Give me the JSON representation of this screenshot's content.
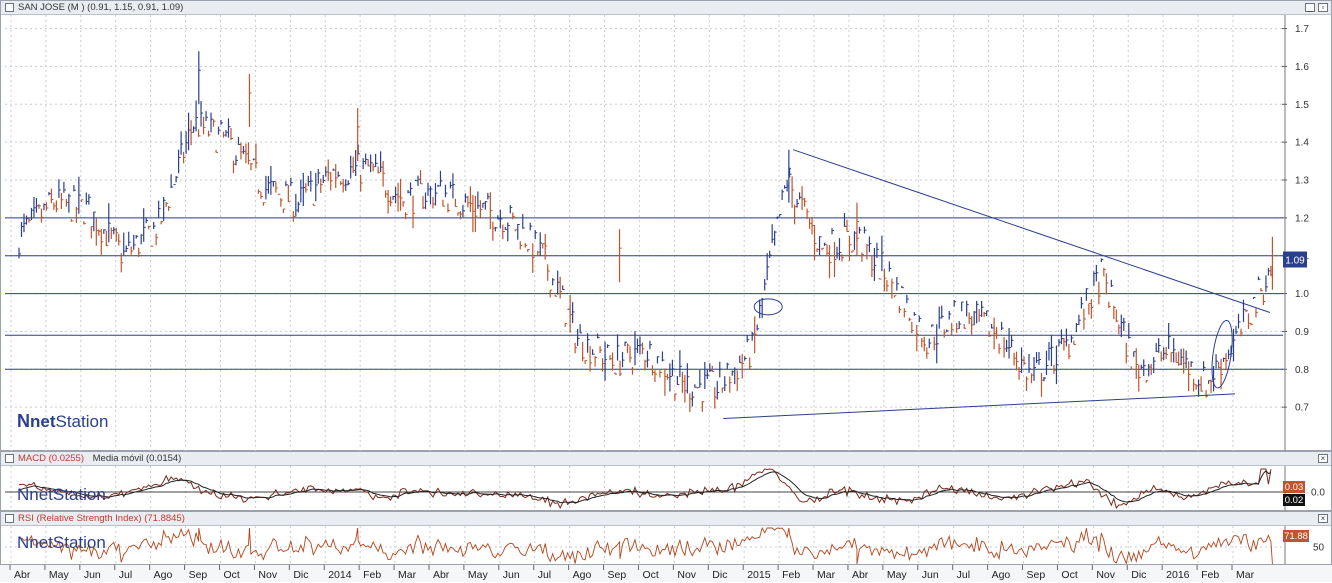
{
  "main_panel": {
    "title": "SAN JOSE (M )",
    "ohlc": "(0.91, 1.15, 0.91, 1.09)",
    "last_price_badge": "1.09",
    "logo_text_net": "net",
    "logo_text_station": "Station"
  },
  "macd_panel": {
    "title": "MACD (0.0255)",
    "subtitle": "Media móvil (0.0154)",
    "badge_macd": "0.03",
    "badge_signal": "0.02"
  },
  "rsi_panel": {
    "title": "RSI (Relative Strength Index) (71.8845)",
    "badge_value": "71.88"
  },
  "colors": {
    "bars_up": "#2b3f8f",
    "bars_down": "#c0542a",
    "hline": "#2b3f8f",
    "grid": "#c8ccd2",
    "rsi_line": "#b5451b",
    "macd_line": "#7a2a1a",
    "signal_line": "#222222",
    "badge_main": "#2b3f8f",
    "badge_rsi": "#c0542a"
  },
  "chart_data": [
    {
      "type": "ohlc",
      "series_name": "SAN JOSE",
      "y_ticks": [
        "0.7",
        "0.8",
        "0.9",
        "1.0",
        "1.1",
        "1.2",
        "1.3",
        "1.4",
        "1.5",
        "1.6",
        "1.7"
      ],
      "ylim": [
        0.6,
        1.72
      ],
      "horizontal_lines": [
        1.2,
        1.1,
        1.0,
        0.89,
        0.8
      ],
      "x_labels": [
        "Abr",
        "May",
        "Jun",
        "Jul",
        "Ago",
        "Sep",
        "Oct",
        "Nov",
        "Dic",
        "2014",
        "Feb",
        "Mar",
        "Abr",
        "May",
        "Jun",
        "Jul",
        "Ago",
        "Sep",
        "Oct",
        "Nov",
        "Dic",
        "2015",
        "Feb",
        "Mar",
        "Abr",
        "May",
        "Jun",
        "Jul",
        "Ago",
        "Sep",
        "Oct",
        "Nov",
        "Dic",
        "2016",
        "Feb",
        "Mar"
      ],
      "key_points": [
        {
          "date": "2013-04",
          "close": 1.15
        },
        {
          "date": "2013-05",
          "close": 1.24
        },
        {
          "date": "2013-06",
          "close": 1.22
        },
        {
          "date": "2013-07",
          "close": 1.1
        },
        {
          "date": "2013-08",
          "close": 1.18
        },
        {
          "date": "2013-09",
          "close": 1.45
        },
        {
          "date": "2013-10",
          "close": 1.4
        },
        {
          "date": "2013-11",
          "close": 1.28
        },
        {
          "date": "2013-12",
          "close": 1.24
        },
        {
          "date": "2014-01",
          "close": 1.32
        },
        {
          "date": "2014-02",
          "close": 1.33
        },
        {
          "date": "2014-03",
          "close": 1.25
        },
        {
          "date": "2014-04",
          "close": 1.27
        },
        {
          "date": "2014-05",
          "close": 1.23
        },
        {
          "date": "2014-06",
          "close": 1.2
        },
        {
          "date": "2014-07",
          "close": 1.1
        },
        {
          "date": "2014-08",
          "close": 0.88
        },
        {
          "date": "2014-09",
          "close": 0.82
        },
        {
          "date": "2014-10",
          "close": 0.85
        },
        {
          "date": "2014-11",
          "close": 0.76
        },
        {
          "date": "2014-12",
          "close": 0.75
        },
        {
          "date": "2015-01",
          "close": 0.85
        },
        {
          "date": "2015-02",
          "close": 1.3
        },
        {
          "date": "2015-03",
          "close": 1.12
        },
        {
          "date": "2015-04",
          "close": 1.15
        },
        {
          "date": "2015-05",
          "close": 1.03
        },
        {
          "date": "2015-06",
          "close": 0.88
        },
        {
          "date": "2015-07",
          "close": 0.95
        },
        {
          "date": "2015-08",
          "close": 0.9
        },
        {
          "date": "2015-09",
          "close": 0.78
        },
        {
          "date": "2015-10",
          "close": 0.86
        },
        {
          "date": "2015-11",
          "close": 1.05
        },
        {
          "date": "2015-12",
          "close": 0.8
        },
        {
          "date": "2016-01",
          "close": 0.85
        },
        {
          "date": "2016-02",
          "close": 0.76
        },
        {
          "date": "2016-03",
          "close": 0.9
        },
        {
          "date": "2016-04",
          "close": 1.09
        }
      ],
      "trendlines": [
        {
          "from": {
            "date": "2015-02",
            "value": 1.38
          },
          "to": {
            "date": "2016-04",
            "value": 0.95
          }
        },
        {
          "from": {
            "date": "2014-12",
            "value": 0.67
          },
          "to": {
            "date": "2016-03",
            "value": 0.735
          }
        }
      ]
    },
    {
      "type": "line",
      "name": "MACD",
      "series": [
        {
          "name": "MACD"
        },
        {
          "name": "Media móvil"
        }
      ],
      "y_ticks": [
        "0.0"
      ]
    },
    {
      "type": "line",
      "name": "RSI",
      "y_ticks": [
        "50"
      ]
    }
  ]
}
